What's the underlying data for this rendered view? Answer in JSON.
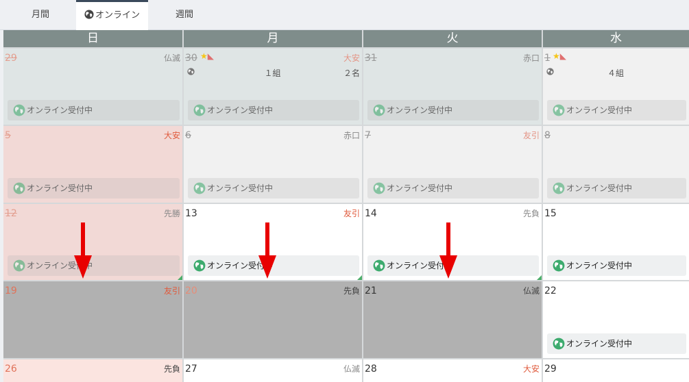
{
  "tabs": [
    {
      "label": "月間"
    },
    {
      "label": "オンライン"
    },
    {
      "label": "週間"
    }
  ],
  "weekdays": [
    "日",
    "月",
    "火",
    "水"
  ],
  "status_label": "オンライン受付中",
  "colors": {
    "header": "#7f8d8b",
    "globe": "#3dab6e",
    "arrow": "#e80000",
    "tab_accent": "#3b4a5c"
  },
  "rows": [
    [
      {
        "day": "29",
        "rokuyo": "仏滅"
      },
      {
        "day": "30",
        "rokuyo": "大安",
        "groups": "１組",
        "people": "２名"
      },
      {
        "day": "31",
        "rokuyo": "赤口"
      },
      {
        "day": "1",
        "groups": "４組"
      }
    ],
    [
      {
        "day": "5",
        "rokuyo": "大安"
      },
      {
        "day": "6",
        "rokuyo": "赤口"
      },
      {
        "day": "7",
        "rokuyo": "友引"
      },
      {
        "day": "8"
      }
    ],
    [
      {
        "day": "12",
        "rokuyo": "先勝"
      },
      {
        "day": "13",
        "rokuyo": "友引"
      },
      {
        "day": "14",
        "rokuyo": "先負"
      },
      {
        "day": "15"
      }
    ],
    [
      {
        "day": "19",
        "rokuyo": "友引"
      },
      {
        "day": "20",
        "rokuyo": "先負"
      },
      {
        "day": "21",
        "rokuyo": "仏滅"
      },
      {
        "day": "22"
      }
    ],
    [
      {
        "day": "26",
        "rokuyo": "先負"
      },
      {
        "day": "27",
        "rokuyo": "仏滅"
      },
      {
        "day": "28",
        "rokuyo": "大安"
      },
      {
        "day": "29"
      }
    ]
  ]
}
